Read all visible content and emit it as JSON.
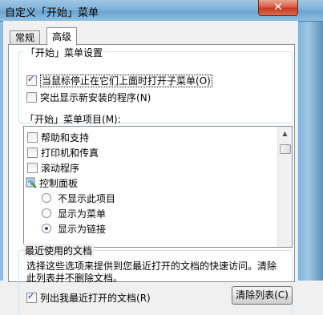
{
  "window": {
    "title": "自定义「开始」菜单",
    "close_symbol": "✕"
  },
  "tabs": [
    {
      "label": "常规"
    },
    {
      "label": "高级"
    }
  ],
  "start_menu_settings": {
    "group_label": "「开始」菜单设置",
    "option1": {
      "label": "当鼠标停止在它们上面时打开子菜单",
      "accel": "(O)",
      "checked": true
    },
    "option2": {
      "label": "突出显示新安装的程序",
      "accel": "(N)",
      "checked": false
    }
  },
  "start_menu_items": {
    "label": "「开始」菜单项目",
    "accel": "(M)",
    "colon": ":",
    "items": [
      {
        "label": "帮助和支持",
        "type": "checkbox",
        "checked": false
      },
      {
        "label": "打印机和传真",
        "type": "checkbox",
        "checked": false
      },
      {
        "label": "滚动程序",
        "type": "checkbox",
        "checked": false
      },
      {
        "label": "控制面板",
        "type": "icon",
        "icon": "control-panel-icon"
      },
      {
        "label": "不显示此项目",
        "type": "radio",
        "checked": false
      },
      {
        "label": "显示为菜单",
        "type": "radio",
        "checked": false
      },
      {
        "label": "显示为链接",
        "type": "radio",
        "checked": true
      }
    ]
  },
  "recent_documents": {
    "group_label": "最近使用的文档",
    "description": "选择这些选项来提供到您最近打开的文档的快速访问。清除此列表并不删除文档。",
    "list_option": {
      "label": "列出我最近打开的文档",
      "accel": "(R)",
      "checked": true
    },
    "clear_button": {
      "label": "清除列表",
      "accel": "(C)"
    }
  }
}
